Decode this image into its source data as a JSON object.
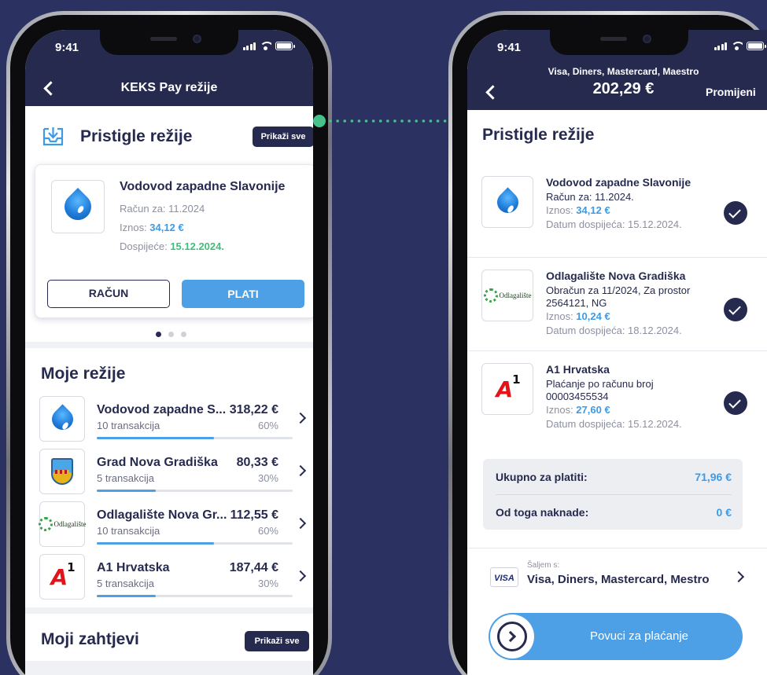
{
  "left": {
    "status_time": "9:41",
    "nav_title": "KEKS Pay režije",
    "incoming": {
      "title": "Pristigle režije",
      "show_all": "Prikaži sve",
      "bill": {
        "name": "Vodovod zapadne Slavonije",
        "period_label": "Račun za: 11.2024",
        "amount_label": "Iznos: ",
        "amount": "34,12 €",
        "due_label": "Dospijeće: ",
        "due": "15.12.2024.",
        "invoice_button": "RAČUN",
        "pay_button": "PLATI"
      }
    },
    "my_bills": {
      "title": "Moje režije",
      "items": [
        {
          "name": "Vodovod zapadne S...",
          "sub": "10 transakcija",
          "amount": "318,22 €",
          "pct": "60%",
          "progress": 0.6,
          "logo": "water-drop-icon"
        },
        {
          "name": "Grad Nova Gradiška",
          "sub": "5 transakcija",
          "amount": "80,33 €",
          "pct": "30%",
          "progress": 0.3,
          "logo": "city-crest-icon"
        },
        {
          "name": "Odlagalište Nova Gr...",
          "sub": "10 transakcija",
          "amount": "112,55 €",
          "pct": "60%",
          "progress": 0.6,
          "logo": "recycling-icon"
        },
        {
          "name": "A1 Hrvatska",
          "sub": "5 transakcija",
          "amount": "187,44 €",
          "pct": "30%",
          "progress": 0.3,
          "logo": "a1-logo"
        }
      ]
    },
    "requests": {
      "title": "Moji zahtjevi",
      "show_all": "Prikaži sve"
    }
  },
  "right": {
    "status_time": "9:41",
    "cards_line": "Visa, Diners, Mastercard, Maestro",
    "total_top": "202,29 €",
    "change": "Promijeni",
    "incoming_title": "Pristigle režije",
    "bills": [
      {
        "name": "Vodovod zapadne Slavonije",
        "lines": [
          "Račun za: 11.2024."
        ],
        "amount_label": "Iznos: ",
        "amount": "34,12 €",
        "due": "Datum dospijeća: 15.12.2024."
      },
      {
        "name": "Odlagalište Nova Gradiška",
        "lines": [
          "Obračun za 11/2024, Za prostor",
          "2564121, NG"
        ],
        "amount_label": "Iznos: ",
        "amount": "10,24 €",
        "due": "Datum dospijeća: 18.12.2024."
      },
      {
        "name": "A1 Hrvatska",
        "lines": [
          "Plaćanje po računu broj",
          "00003455534"
        ],
        "amount_label": "Iznos: ",
        "amount": "27,60 €",
        "due": "Datum dospijeća: 15.12.2024."
      }
    ],
    "summary": {
      "total_label": "Ukupno za platiti:",
      "total_value": "71,96 €",
      "fee_label": "Od toga naknade:",
      "fee_value": "0 €"
    },
    "payment": {
      "send_with": "Šaljem s:",
      "methods": "Visa, Diners, Mastercard, Mestro",
      "card_brand": "VISA"
    },
    "slide_label": "Povuci za plaćanje"
  },
  "logo_texts": {
    "recycling": "Odlagalište"
  },
  "colors": {
    "background": "#2b3262",
    "navy": "#262a4f",
    "accent_blue": "#4d9fe6",
    "amount_blue": "#3f9ae6",
    "due_green": "#3fbf7a",
    "connector_green": "#45c28a"
  }
}
